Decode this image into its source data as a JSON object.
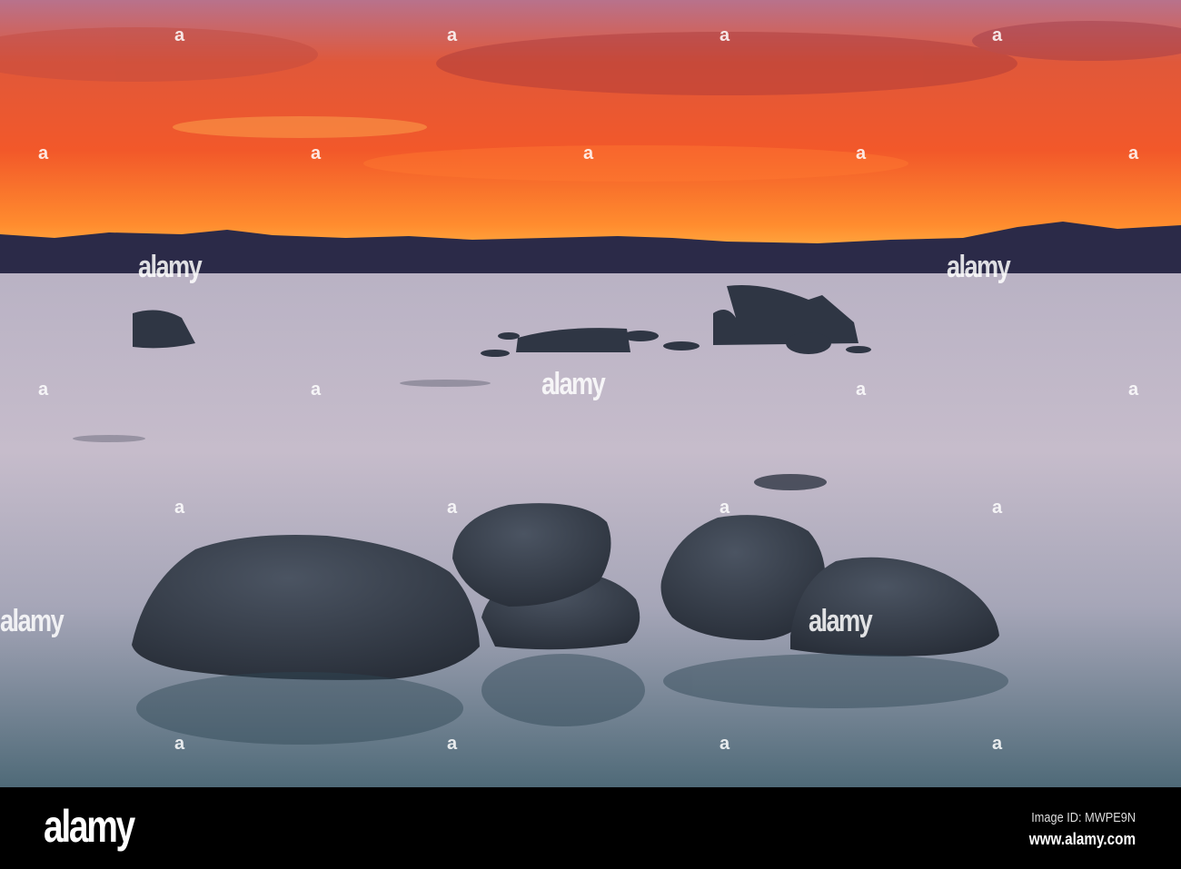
{
  "photo": {
    "watermark": "alamy",
    "watermark_mark": "a",
    "colors": {
      "sky_top": "#b8728c",
      "sky_mid": "#f0542a",
      "horizon": "#ff9a30",
      "mountains": "#2b2a48",
      "water_top": "#c4bccb",
      "water_bottom": "#4f6a78",
      "rock": "#3b4452"
    }
  },
  "footer": {
    "logo": "alamy",
    "image_id": "Image ID: MWPE9N",
    "website": "www.alamy.com"
  }
}
